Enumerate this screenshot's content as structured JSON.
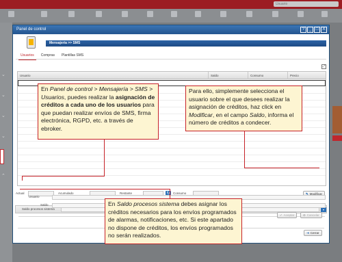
{
  "app": {
    "search_placeholder": "Usuario"
  },
  "dialog": {
    "title": "Panel de control",
    "title_buttons": [
      "?",
      "_",
      "□",
      "X"
    ],
    "breadcrumb": "Mensajería >> SMS",
    "module_icon": "phone-sms-icon"
  },
  "tabs": [
    {
      "label": "Usuarios",
      "active": true
    },
    {
      "label": "Compras",
      "active": false
    },
    {
      "label": "Plantillas SMS",
      "active": false
    }
  ],
  "grid": {
    "columns": [
      "Usuario",
      "Saldo",
      "Consumo",
      "Precio"
    ]
  },
  "balance": {
    "actual_label": "Actual",
    "accumulated_label": "Acumulado",
    "remaining_label": "Restante",
    "consumption_label": "Consumo",
    "modify_button": "Modificar"
  },
  "system": {
    "bar_label": "Saldo procesos sistema",
    "user_label": "Usuario",
    "balance_label": "Saldo",
    "accept_button": "Aceptar",
    "cancel_button": "Cancelar"
  },
  "footer": {
    "close_button": "Cerrar"
  },
  "callouts": {
    "left_html": "En <i>Panel de control &gt; Mensajería &gt; SMS &gt; Usuarios</i>, puedes realizar la <b>asignación de créditos a cada uno de los usuarios</b> para que puedan realizar envíos de SMS, firma electrónica, RGPD, etc. a través de ebroker.",
    "right_html": "Para ello, simplemente selecciona el usuario sobre el que desees realizar la asignación de créditos, haz click en <i>Modificar</i>, en el campo <i>Saldo</i>, informa el número de créditos a condecer.",
    "bottom_html": "En <i>Saldo procesos sistema</i> debes asignar los créditos necesarios para los envíos programados de alarmas, notificaciones, etc. Si este apartado no dispone de créditos, los envíos programados no serán realizados."
  },
  "colors": {
    "accent_red": "#c62026",
    "header_blue": "#24558f",
    "callout_bg": "#fdf5d2"
  }
}
